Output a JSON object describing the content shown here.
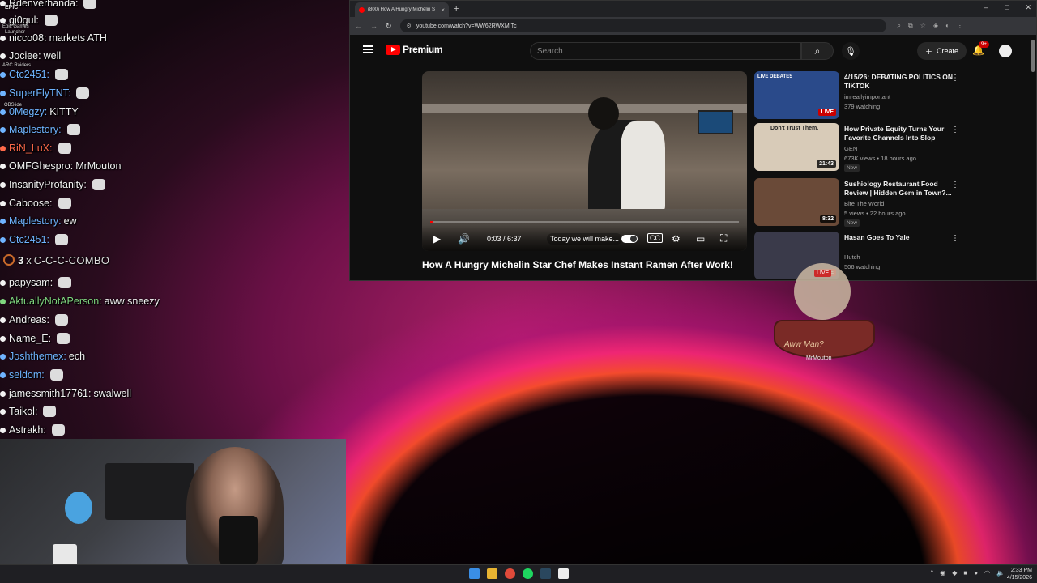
{
  "desktop": {
    "epic_label": "EPIC",
    "epic_sub": "Epic Games",
    "epic_sub2": "Launcher",
    "arc_label": "ARC Raiders",
    "obs_label": "OBSlide"
  },
  "chat": {
    "lines": [
      {
        "user": "Rdenverhanda:",
        "text": "",
        "color": "#f2f2f2"
      },
      {
        "user": "gi0gul:",
        "text": "",
        "color": "#f2f2f2"
      },
      {
        "user": "nicco08:",
        "text": "markets ATH",
        "color": "#f2f2f2"
      },
      {
        "user": "Jociee:",
        "text": "well",
        "color": "#f2f2f2"
      },
      {
        "user": "Ctc2451:",
        "text": "",
        "color": "#6fb4ff"
      },
      {
        "user": "SuperFlyTNT:",
        "text": "",
        "color": "#6fb4ff"
      },
      {
        "user": "0Megzy:",
        "text": "KITTY",
        "color": "#6fb4ff"
      },
      {
        "user": "Maplestory:",
        "text": "",
        "color": "#6fb4ff"
      },
      {
        "user": "RiN_LuX:",
        "text": "",
        "color": "#ff6a4a"
      },
      {
        "user": "OMFGhespro:",
        "text": "MrMouton",
        "color": "#f2f2f2"
      },
      {
        "user": "InsanityProfanity:",
        "text": "",
        "color": "#f2f2f2"
      },
      {
        "user": "Caboose:",
        "text": "",
        "color": "#f2f2f2"
      },
      {
        "user": "Maplestory:",
        "text": "ew",
        "color": "#6fb4ff"
      },
      {
        "user": "Ctc2451:",
        "text": "",
        "color": "#6fb4ff"
      },
      {
        "user": "papysam:",
        "text": "",
        "color": "#f2f2f2"
      },
      {
        "user": "AktuallyNotAPerson:",
        "text": "aww sneezy",
        "color": "#7fd67f"
      },
      {
        "user": "Andreas:",
        "text": "",
        "color": "#f2f2f2"
      },
      {
        "user": "Name_E:",
        "text": "",
        "color": "#f2f2f2"
      },
      {
        "user": "Joshthemex:",
        "text": "ech",
        "color": "#6fb4ff"
      },
      {
        "user": "seldom:",
        "text": "",
        "color": "#6fb4ff"
      },
      {
        "user": "jamessmith17761:",
        "text": "swalwell",
        "color": "#f2f2f2"
      },
      {
        "user": "Taikol:",
        "text": "",
        "color": "#f2f2f2"
      },
      {
        "user": "Astrakh:",
        "text": "",
        "color": "#f2f2f2"
      }
    ],
    "combo": {
      "count": "3",
      "x": "x",
      "label": "C-C-C-COMBO"
    }
  },
  "browser": {
    "tab_title": "(800) How A Hungry Michelin S",
    "tab_close": "×",
    "new_tab": "+",
    "url": "youtube.com/watch?v=WW62RWXMITc",
    "win_min": "–",
    "win_max": "□",
    "win_close": "✕"
  },
  "youtube": {
    "brand": "Premium",
    "search_placeholder": "Search",
    "create_label": "Create",
    "notif_count": "9+",
    "video": {
      "title": "How A Hungry Michelin Star Chef Makes Instant Ramen After Work!",
      "time": "0:03 / 6:37",
      "chapter": "Today we will make...",
      "progress": 0.008
    },
    "recommendations": [
      {
        "title": "4/15/26: DEBATING POLITICS ON TIKTOK",
        "channel": "imreallyimportant",
        "meta": "379 watching",
        "badge": "LIVE",
        "badge_type": "live",
        "new": "",
        "thumb_color": "#2a4a8a"
      },
      {
        "title": "How Private Equity Turns Your Favorite Channels Into Slop",
        "channel": "GEN",
        "meta": "673K views • 18 hours ago",
        "badge": "21:43",
        "badge_type": "dur",
        "new": "New",
        "thumb_color": "#d8cbb8"
      },
      {
        "title": "Sushiology Restaurant Food Review | Hidden Gem in Town?...",
        "channel": "Bite The World",
        "meta": "5 views • 22 hours ago",
        "badge": "8:32",
        "badge_type": "dur",
        "new": "New",
        "thumb_color": "#6a4a38"
      },
      {
        "title": "Hasan Goes To Yale",
        "channel": "Hutch",
        "meta": "506 watching",
        "badge": "LIVE",
        "badge_type": "live",
        "new": "",
        "thumb_color": "#3a3a4a"
      }
    ],
    "thumb1_text": "LIVE DEBATES",
    "thumb2_text": "Don't Trust Them."
  },
  "overlay": {
    "live_badge": "LIVE",
    "bowl_text": "Aww Man?",
    "name": "MrMouton"
  },
  "taskbar": {
    "time": "2:33 PM",
    "date": "4/15/2026"
  }
}
